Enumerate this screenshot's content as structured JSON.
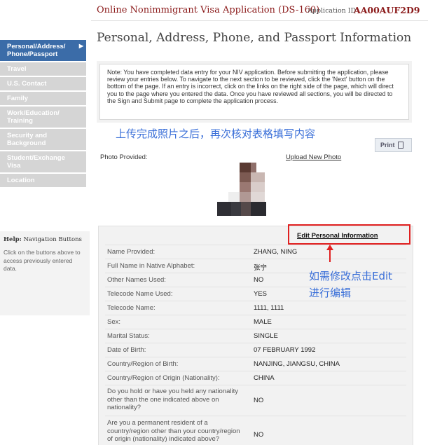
{
  "header": {
    "app_title": "Online Nonimmigrant Visa Application (DS-160)",
    "app_id_label": "Application ID",
    "app_id": "AA00AUF2D9"
  },
  "page_title": "Personal, Address, Phone, and Passport Information",
  "sidebar": {
    "items": [
      {
        "label": "Personal/Address/ Phone/Passport",
        "active": true
      },
      {
        "label": "Travel"
      },
      {
        "label": "U.S. Contact"
      },
      {
        "label": "Family"
      },
      {
        "label": "Work/Education/ Training"
      },
      {
        "label": "Security and Background"
      },
      {
        "label": "Student/Exchange Visa"
      },
      {
        "label": "Location"
      }
    ],
    "active_arrow": "▶"
  },
  "help": {
    "title_bold": "Help:",
    "title_rest": " Navigation Buttons",
    "text": "Click on the buttons above to access previously entered data."
  },
  "note": {
    "text": "Note: You have completed data entry for your NIV application. Before submitting the application, please review your entries below. To navigate to the next section to be reviewed, click the 'Next' button on the bottom of the page. If an entry is incorrect, click on the links on the right side of the page, which will direct you to the page where you entered the data. Once you have reviewed all sections, you will be directed to the Sign and Submit page to complete the application process."
  },
  "annotations": {
    "after_photo": "上传完成照片之后，再次核对表格填写内容",
    "edit_line1": "如需修改点击Edit",
    "edit_line2": "进行编辑"
  },
  "print_button": "Print",
  "photo": {
    "label": "Photo Provided:",
    "upload_link": "Upload New Photo"
  },
  "personal": {
    "edit_link": "Edit Personal Information",
    "rows": [
      {
        "label": "Name Provided:",
        "value": "ZHANG, NING"
      },
      {
        "label": "Full Name in Native Alphabet:",
        "value": "张宁"
      },
      {
        "label": " Other Names Used:",
        "value": "NO"
      },
      {
        "label": "Telecode Name Used:",
        "value": "YES"
      },
      {
        "label": "Telecode Name:",
        "value": "1111, 1111"
      },
      {
        "label": "Sex:",
        "value": "MALE"
      },
      {
        "label": "Marital Status:",
        "value": "SINGLE"
      },
      {
        "label": "Date of Birth:",
        "value": "07 FEBRUARY 1992"
      },
      {
        "label": "Country/Region of Birth:",
        "value": "NANJING, JIANGSU, CHINA"
      },
      {
        "label": "Country/Region of Origin (Nationality):",
        "value": "CHINA"
      },
      {
        "label": "Do you hold or have you held any nationality other than the one indicated above on nationality?",
        "value": "NO"
      },
      {
        "label": "Are you a permanent resident of a country/region other than your country/region of origin (nationality) indicated above?",
        "value": "NO"
      }
    ]
  },
  "colors": {
    "accent_red": "#8b1a1a",
    "nav_active": "#3b6ca8",
    "nav_inactive": "#d5d5d5",
    "annotation_blue": "#3a6fd8",
    "highlight_red": "#e02020"
  }
}
